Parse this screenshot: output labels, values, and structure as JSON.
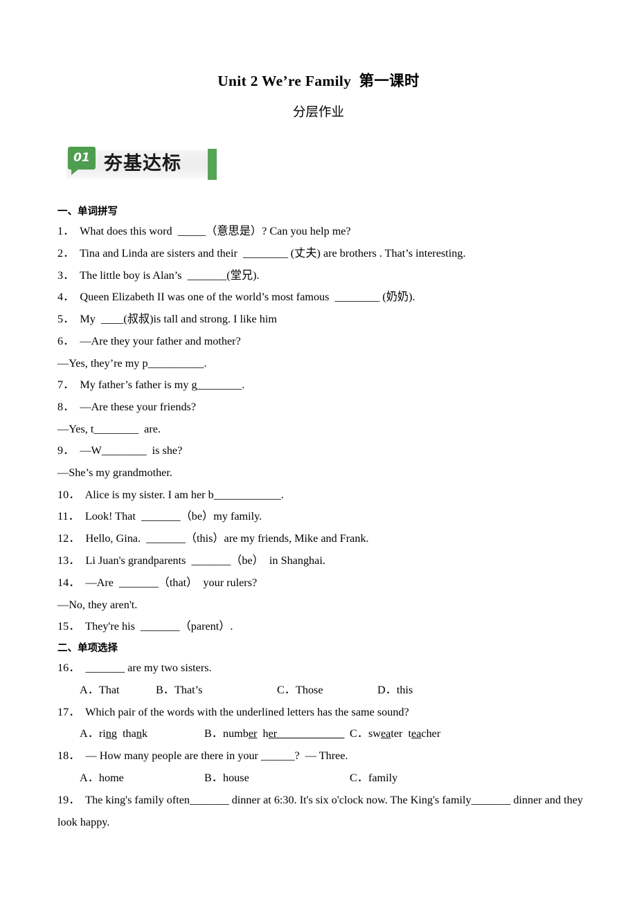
{
  "document": {
    "title": "Unit 2 We’re Family  第一课时",
    "subtitle": "分层作业"
  },
  "banner": {
    "number": "01",
    "label": "夯基达标",
    "badge_color": "#4f9e4f",
    "bar_color": "#57a457",
    "background_color": "#efefef"
  },
  "sections": [
    {
      "heading": "一、单词拼写",
      "questions": [
        {
          "number": "1．",
          "text": "What does this word  _____（意思是）? Can you help me?"
        },
        {
          "number": "2．",
          "text": "Tina and Linda are sisters and their  ________ (丈夫) are brothers . That’s interesting."
        },
        {
          "number": "3．",
          "text": "The little boy is Alan’s  _______(堂兄)."
        },
        {
          "number": "4．",
          "text": "Queen Elizabeth II was one of the world’s most famous  ________ (奶奶)."
        },
        {
          "number": "5．",
          "text": "My  ____(叔叔)is tall and strong. I like him"
        },
        {
          "number": "6．",
          "text": "—Are they your father and mother?"
        },
        {
          "number": "",
          "text": "—Yes, they’re my p__________."
        },
        {
          "number": "7．",
          "text": "My father’s father is my g________."
        },
        {
          "number": "8．",
          "text": "—Are these your friends?"
        },
        {
          "number": "",
          "text": "—Yes, t________  are."
        },
        {
          "number": "9．",
          "text": "—W________  is she?"
        },
        {
          "number": "",
          "text": "—She’s my grandmother."
        },
        {
          "number": "10．",
          "text": "Alice is my sister. I am her b____________."
        },
        {
          "number": "11．",
          "text": "Look! That  _______（be）my family."
        },
        {
          "number": "12．",
          "text": "Hello, Gina.  _______（this）are my friends, Mike and Frank."
        },
        {
          "number": "13．",
          "text": "Li Juan's grandparents  _______（be）  in Shanghai."
        },
        {
          "number": "14．",
          "text": "—Are  _______（that）  your rulers?"
        },
        {
          "number": "",
          "text": "—No, they aren't."
        },
        {
          "number": "15．",
          "text": "They're his  _______（parent）."
        }
      ]
    },
    {
      "heading": "二、单项选择",
      "questions": [
        {
          "number": "16．",
          "text": "_______ are my two sisters.",
          "options": [
            "A．That",
            "B．That’s",
            "C．Those",
            "D．this"
          ]
        },
        {
          "number": "17．",
          "text": "Which pair of the words with the underlined letters has the same sound?",
          "options_rich": [
            {
              "label": "A．",
              "parts": [
                {
                  "t": "ri",
                  "u": false
                },
                {
                  "t": "n",
                  "u": true
                },
                {
                  "t": "g  tha",
                  "u": false
                },
                {
                  "t": "n",
                  "u": true
                },
                {
                  "t": "k",
                  "u": false
                }
              ]
            },
            {
              "label": "B．",
              "parts": [
                {
                  "t": "numb",
                  "u": false
                },
                {
                  "t": "er",
                  "u": true
                },
                {
                  "t": "  h",
                  "u": false
                },
                {
                  "t": "er",
                  "u": true
                },
                {
                  "t": "____________",
                  "u": true
                }
              ]
            },
            {
              "label": "C．",
              "parts": [
                {
                  "t": "sw",
                  "u": false
                },
                {
                  "t": "ea",
                  "u": true
                },
                {
                  "t": "ter  t",
                  "u": false
                },
                {
                  "t": "ea",
                  "u": true
                },
                {
                  "t": "cher",
                  "u": false
                }
              ]
            }
          ]
        },
        {
          "number": "18．",
          "text": "— How many people are there in your ______?  — Three.",
          "options": [
            "A．home",
            "B．house",
            "C．family"
          ]
        },
        {
          "number": "19．",
          "text": "The king's family often_______ dinner at 6:30. It's six o'clock now. The King's family_______ dinner and they",
          "continuation": "look happy."
        }
      ]
    }
  ]
}
